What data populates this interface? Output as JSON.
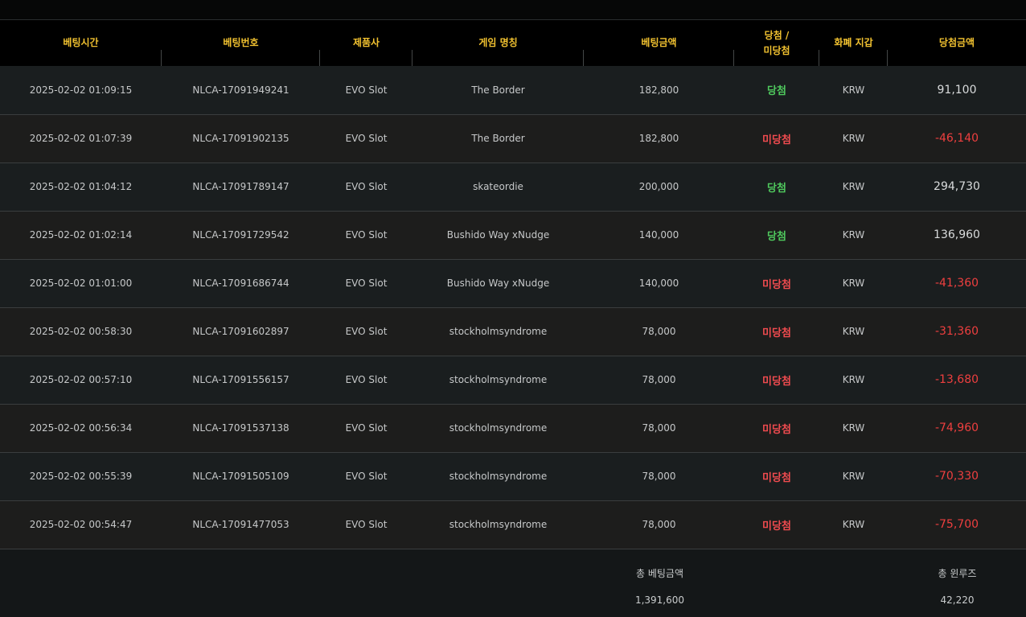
{
  "table": {
    "headers": {
      "time": "베팅시간",
      "bet_id": "베팅번호",
      "provider": "제품사",
      "game": "게임 명칭",
      "amount": "베팅금액",
      "result_line1": "당첨 /",
      "result_line2": "미당첨",
      "wallet": "화폐 지갑",
      "payout": "당첨금액"
    },
    "rows": [
      {
        "time": "2025-02-02 01:09:15",
        "bet_id": "NLCA-17091949241",
        "provider": "EVO Slot",
        "game": "The Border",
        "amount": "182,800",
        "result": "당첨",
        "won": true,
        "wallet": "KRW",
        "payout": "91,100"
      },
      {
        "time": "2025-02-02 01:07:39",
        "bet_id": "NLCA-17091902135",
        "provider": "EVO Slot",
        "game": "The Border",
        "amount": "182,800",
        "result": "미당첨",
        "won": false,
        "wallet": "KRW",
        "payout": "-46,140"
      },
      {
        "time": "2025-02-02 01:04:12",
        "bet_id": "NLCA-17091789147",
        "provider": "EVO Slot",
        "game": "skateordie",
        "amount": "200,000",
        "result": "당첨",
        "won": true,
        "wallet": "KRW",
        "payout": "294,730"
      },
      {
        "time": "2025-02-02 01:02:14",
        "bet_id": "NLCA-17091729542",
        "provider": "EVO Slot",
        "game": "Bushido Way xNudge",
        "amount": "140,000",
        "result": "당첨",
        "won": true,
        "wallet": "KRW",
        "payout": "136,960"
      },
      {
        "time": "2025-02-02 01:01:00",
        "bet_id": "NLCA-17091686744",
        "provider": "EVO Slot",
        "game": "Bushido Way xNudge",
        "amount": "140,000",
        "result": "미당첨",
        "won": false,
        "wallet": "KRW",
        "payout": "-41,360"
      },
      {
        "time": "2025-02-02 00:58:30",
        "bet_id": "NLCA-17091602897",
        "provider": "EVO Slot",
        "game": "stockholmsyndrome",
        "amount": "78,000",
        "result": "미당첨",
        "won": false,
        "wallet": "KRW",
        "payout": "-31,360"
      },
      {
        "time": "2025-02-02 00:57:10",
        "bet_id": "NLCA-17091556157",
        "provider": "EVO Slot",
        "game": "stockholmsyndrome",
        "amount": "78,000",
        "result": "미당첨",
        "won": false,
        "wallet": "KRW",
        "payout": "-13,680"
      },
      {
        "time": "2025-02-02 00:56:34",
        "bet_id": "NLCA-17091537138",
        "provider": "EVO Slot",
        "game": "stockholmsyndrome",
        "amount": "78,000",
        "result": "미당첨",
        "won": false,
        "wallet": "KRW",
        "payout": "-74,960"
      },
      {
        "time": "2025-02-02 00:55:39",
        "bet_id": "NLCA-17091505109",
        "provider": "EVO Slot",
        "game": "stockholmsyndrome",
        "amount": "78,000",
        "result": "미당첨",
        "won": false,
        "wallet": "KRW",
        "payout": "-70,330"
      },
      {
        "time": "2025-02-02 00:54:47",
        "bet_id": "NLCA-17091477053",
        "provider": "EVO Slot",
        "game": "stockholmsyndrome",
        "amount": "78,000",
        "result": "미당첨",
        "won": false,
        "wallet": "KRW",
        "payout": "-75,700"
      }
    ]
  },
  "summary": {
    "total_bet_label": "총 베팅금액",
    "total_bet_value": "1,391,600",
    "total_winloss_label": "총 윈루즈",
    "total_winloss_value": "42,220"
  },
  "colors": {
    "header_text": "#f2c230",
    "win": "#4fc95d",
    "lose": "#ef4b4f",
    "negative_amount": "#ee3f3f"
  }
}
